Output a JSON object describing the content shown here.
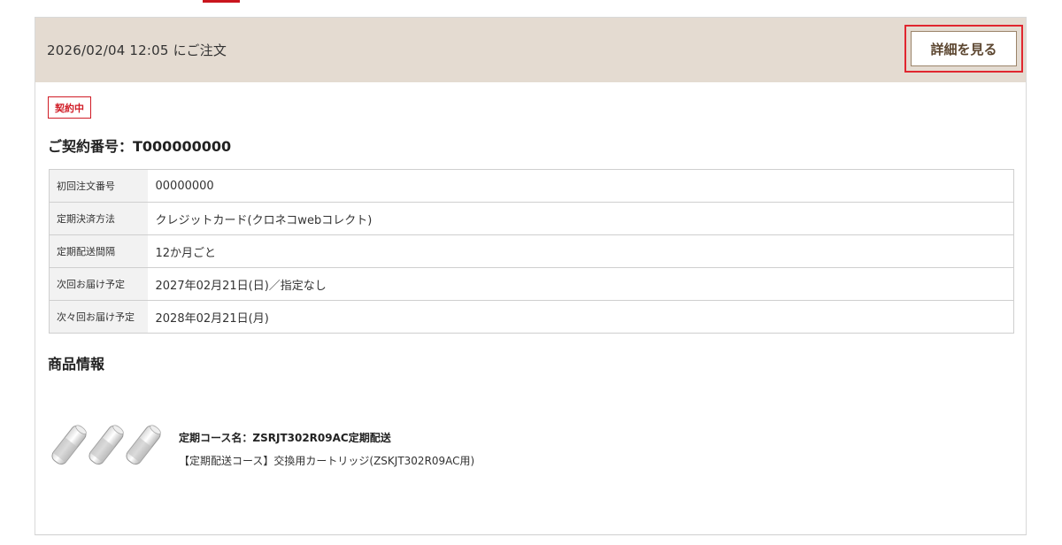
{
  "order": {
    "date_text": "2026/02/04 12:05 にご注文",
    "detail_button_label": "詳細を見る"
  },
  "contract": {
    "status_badge": "契約中",
    "title": "ご契約番号：T000000000",
    "rows": [
      {
        "label": "初回注文番号",
        "value": "00000000"
      },
      {
        "label": "定期決済方法",
        "value": "クレジットカード(クロネコwebコレクト)"
      },
      {
        "label": "定期配送間隔",
        "value": "12か月ごと"
      },
      {
        "label": "次回お届け予定",
        "value": "2027年02月21日(日)／指定なし"
      },
      {
        "label": "次々回お届け予定",
        "value": "2028年02月21日(月)"
      }
    ]
  },
  "product": {
    "section_title": "商品情報",
    "image_icon": "cartridge-set-icon",
    "course_name": "定期コース名：ZSRJT302R09AC定期配送",
    "description": "【定期配送コース】交換用カートリッジ(ZSKJT302R09AC用)"
  },
  "colors": {
    "header_bg": "#e4dbd1",
    "accent_red": "#d01c26",
    "button_text": "#5c4630"
  }
}
